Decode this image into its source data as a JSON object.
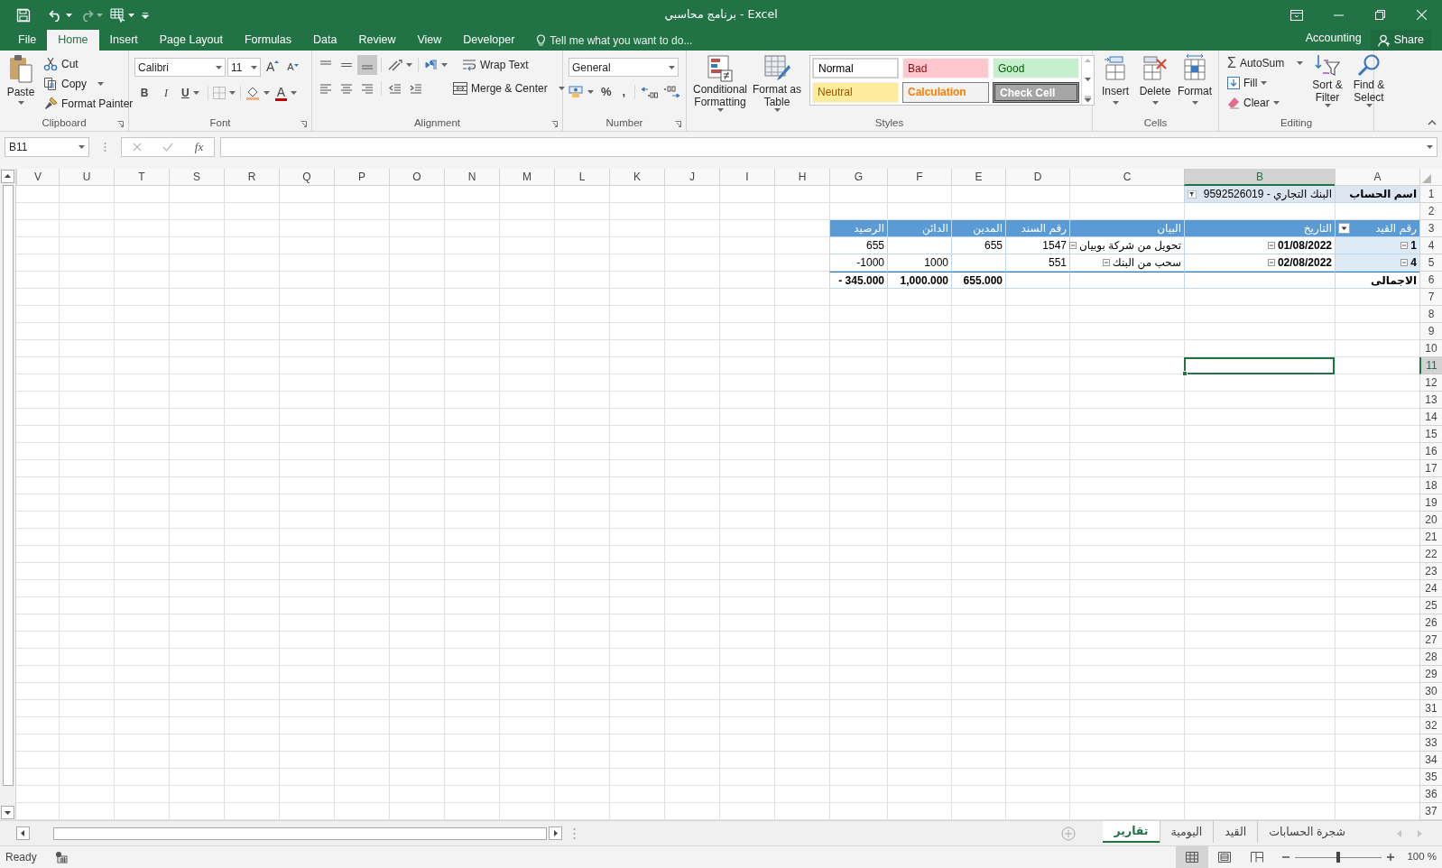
{
  "window": {
    "title": "برنامج محاسبي - Excel"
  },
  "ribbon_tabs": [
    {
      "label": "File",
      "selected": false
    },
    {
      "label": "Home",
      "selected": true
    },
    {
      "label": "Insert",
      "selected": false
    },
    {
      "label": "Page Layout",
      "selected": false
    },
    {
      "label": "Formulas",
      "selected": false
    },
    {
      "label": "Data",
      "selected": false
    },
    {
      "label": "Review",
      "selected": false
    },
    {
      "label": "View",
      "selected": false
    },
    {
      "label": "Developer",
      "selected": false
    }
  ],
  "tell_me": {
    "placeholder": "Tell me what you want to do..."
  },
  "account": "Accounting",
  "share_button": "Share",
  "clipboard": {
    "paste": "Paste",
    "cut": "Cut",
    "copy": "Copy",
    "format_painter": "Format Painter",
    "label": "Clipboard"
  },
  "font": {
    "name": "Calibri",
    "size": "11",
    "grow": "A",
    "shrink": "A",
    "bold": "B",
    "italic": "I",
    "underline": "U",
    "font_color": "A",
    "label": "Font"
  },
  "alignment": {
    "wrap_text": "Wrap Text",
    "merge_center": "Merge & Center",
    "label": "Alignment"
  },
  "number": {
    "format": "General",
    "percent": "%",
    "comma": ",",
    "label": "Number"
  },
  "styles": {
    "conditional_formatting": "Conditional Formatting",
    "format_as_table": "Format as Table",
    "label": "Styles",
    "cell_styles": [
      {
        "label": "Normal",
        "kind": "normal"
      },
      {
        "label": "Bad",
        "kind": "bad"
      },
      {
        "label": "Good",
        "kind": "good"
      },
      {
        "label": "Neutral",
        "kind": "neutral"
      },
      {
        "label": "Calculation",
        "kind": "calculation"
      },
      {
        "label": "Check Cell",
        "kind": "check"
      }
    ]
  },
  "cells_group": {
    "buttons": [
      {
        "label": "Insert",
        "kind": "insert"
      },
      {
        "label": "Delete",
        "kind": "delete"
      },
      {
        "label": "Format",
        "kind": "format"
      }
    ],
    "label": "Cells"
  },
  "editing": {
    "autosum_symbol": "Σ",
    "autosum": "AutoSum",
    "fill": "Fill",
    "clear": "Clear",
    "sort_filter": "Sort & Filter",
    "find_select": "Find & Select",
    "label": "Editing"
  },
  "formula_bar": {
    "name_box": "B11",
    "function_label": "fx"
  },
  "columns": [
    {
      "letter": "V",
      "selected": false
    },
    {
      "letter": "U",
      "selected": false
    },
    {
      "letter": "T",
      "selected": false
    },
    {
      "letter": "S",
      "selected": false
    },
    {
      "letter": "R",
      "selected": false
    },
    {
      "letter": "Q",
      "selected": false
    },
    {
      "letter": "P",
      "selected": false
    },
    {
      "letter": "O",
      "selected": false
    },
    {
      "letter": "N",
      "selected": false
    },
    {
      "letter": "M",
      "selected": false
    },
    {
      "letter": "L",
      "selected": false
    },
    {
      "letter": "K",
      "selected": false
    },
    {
      "letter": "J",
      "selected": false
    },
    {
      "letter": "I",
      "selected": false
    },
    {
      "letter": "H",
      "selected": false
    },
    {
      "letter": "G",
      "selected": false
    },
    {
      "letter": "F",
      "selected": false
    },
    {
      "letter": "E",
      "selected": false
    },
    {
      "letter": "D",
      "selected": false
    },
    {
      "letter": "C",
      "selected": false
    },
    {
      "letter": "B",
      "selected": true
    },
    {
      "letter": "A",
      "selected": false
    }
  ],
  "rows": [
    {
      "number": "1",
      "selected": false
    },
    {
      "number": "2",
      "selected": false
    },
    {
      "number": "3",
      "selected": false
    },
    {
      "number": "4",
      "selected": false
    },
    {
      "number": "5",
      "selected": false
    },
    {
      "number": "6",
      "selected": false
    },
    {
      "number": "7",
      "selected": false
    },
    {
      "number": "8",
      "selected": false
    },
    {
      "number": "9",
      "selected": false
    },
    {
      "number": "10",
      "selected": false
    },
    {
      "number": "11",
      "selected": true
    },
    {
      "number": "12",
      "selected": false
    },
    {
      "number": "13",
      "selected": false
    },
    {
      "number": "14",
      "selected": false
    },
    {
      "number": "15",
      "selected": false
    },
    {
      "number": "16",
      "selected": false
    },
    {
      "number": "17",
      "selected": false
    },
    {
      "number": "18",
      "selected": false
    },
    {
      "number": "19",
      "selected": false
    },
    {
      "number": "20",
      "selected": false
    },
    {
      "number": "21",
      "selected": false
    },
    {
      "number": "22",
      "selected": false
    },
    {
      "number": "23",
      "selected": false
    },
    {
      "number": "24",
      "selected": false
    },
    {
      "number": "25",
      "selected": false
    },
    {
      "number": "26",
      "selected": false
    },
    {
      "number": "27",
      "selected": false
    },
    {
      "number": "28",
      "selected": false
    },
    {
      "number": "29",
      "selected": false
    },
    {
      "number": "30",
      "selected": false
    },
    {
      "number": "31",
      "selected": false
    },
    {
      "number": "32",
      "selected": false
    },
    {
      "number": "33",
      "selected": false
    },
    {
      "number": "34",
      "selected": false
    },
    {
      "number": "35",
      "selected": false
    },
    {
      "number": "36",
      "selected": false
    },
    {
      "number": "37",
      "selected": false
    }
  ],
  "pivot": {
    "filter_label": "اسم الحساب",
    "filter_value": "البنك التجاري - 9592526019",
    "headers": [
      "رقم القيد",
      "التاريخ",
      "البيان",
      "رقم السند",
      "المدين",
      "الدائن",
      "الرصيد"
    ],
    "rows": [
      {
        "entry": "1",
        "date": "01/08/2022",
        "description": "تحويل من شركة بوبيان",
        "voucher": "1547",
        "debit": "655",
        "balance": "655"
      },
      {
        "entry": "4",
        "date": "02/08/2022",
        "description": "سحب من البنك",
        "voucher": "551",
        "credit": "1000",
        "balance": "-1000"
      }
    ],
    "total_label": "الاجمالى",
    "totals": [
      "- 345.000",
      "1,000.000",
      "655.000"
    ]
  },
  "sheet_tabs": [
    {
      "label": "شجرة الحسابات",
      "selected": false
    },
    {
      "label": "القيد",
      "selected": false
    },
    {
      "label": "اليومية",
      "selected": false
    },
    {
      "label": "تقارير",
      "selected": true
    }
  ],
  "status": "Ready",
  "views": [
    {
      "kind": "normal",
      "selected": true
    },
    {
      "kind": "page_layout",
      "selected": false
    },
    {
      "kind": "page_break",
      "selected": false
    }
  ],
  "zoom": {
    "level": 0.5,
    "reading": "100 %"
  }
}
